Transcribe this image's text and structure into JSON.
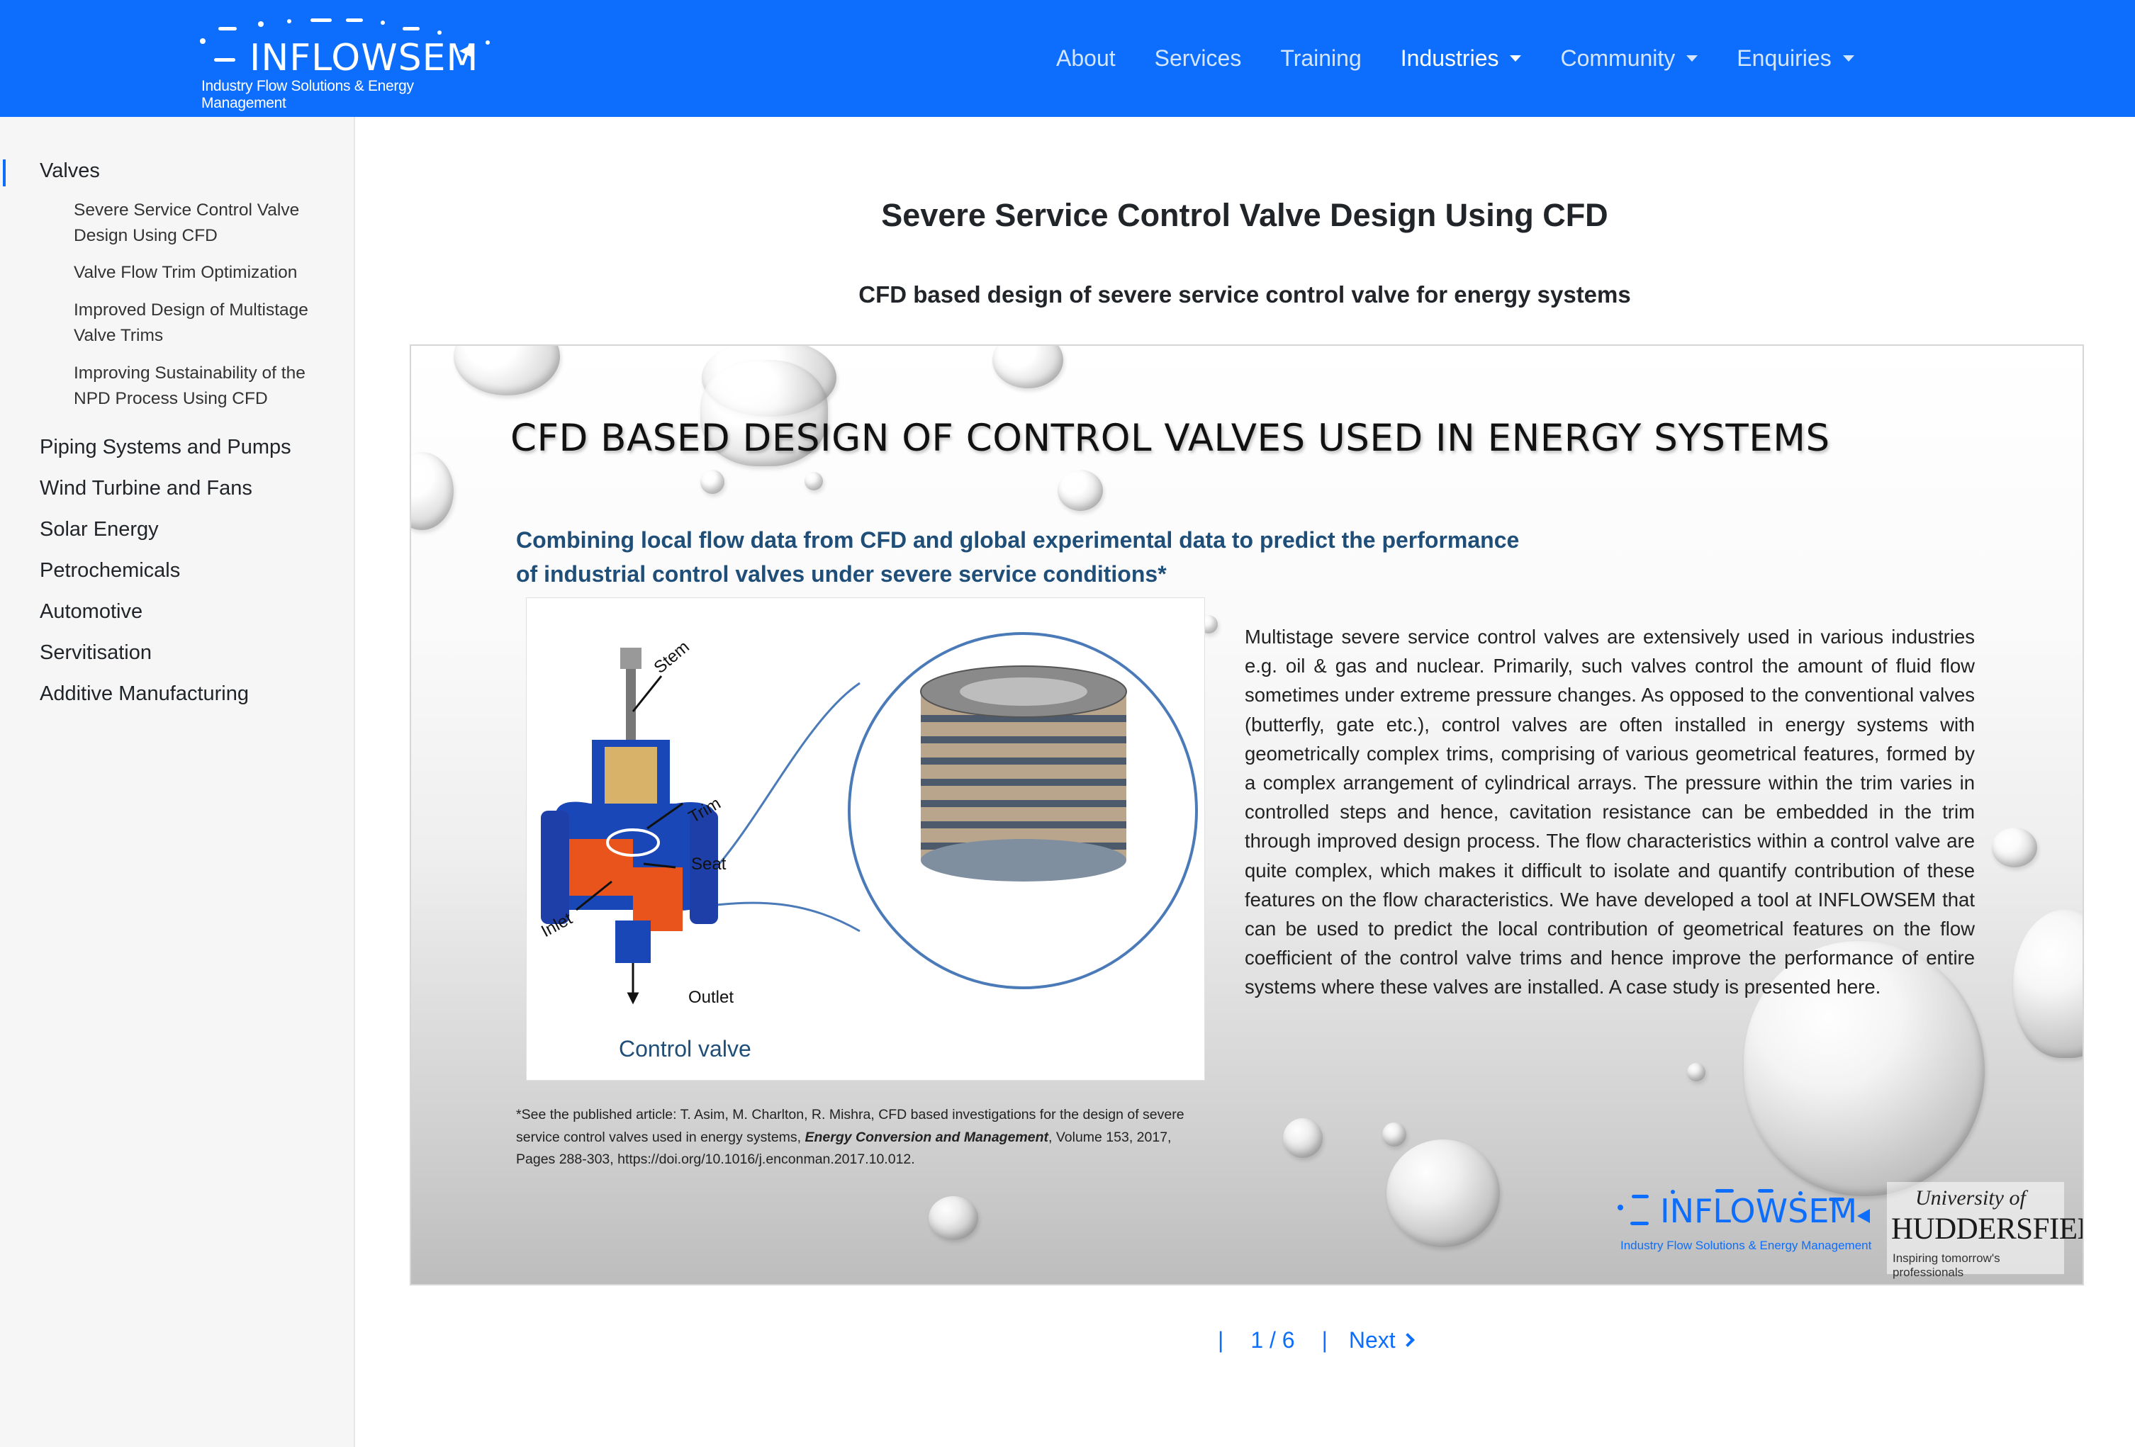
{
  "brand": {
    "name": "INFLOWSEM",
    "tagline": "Industry Flow Solutions & Energy Management"
  },
  "nav": {
    "items": [
      {
        "label": "About",
        "dropdown": false,
        "active": false
      },
      {
        "label": "Services",
        "dropdown": false,
        "active": false
      },
      {
        "label": "Training",
        "dropdown": false,
        "active": false
      },
      {
        "label": "Industries",
        "dropdown": true,
        "active": true
      },
      {
        "label": "Community",
        "dropdown": true,
        "active": false
      },
      {
        "label": "Enquiries",
        "dropdown": true,
        "active": false
      }
    ]
  },
  "sidebar": {
    "categories": [
      {
        "label": "Valves",
        "active": true
      },
      {
        "label": "Piping Systems and Pumps"
      },
      {
        "label": "Wind Turbine and Fans"
      },
      {
        "label": "Solar Energy"
      },
      {
        "label": "Petrochemicals"
      },
      {
        "label": "Automotive"
      },
      {
        "label": "Servitisation"
      },
      {
        "label": "Additive Manufacturing"
      }
    ],
    "valves_sub": [
      "Severe Service Control Valve Design Using CFD",
      "Valve Flow Trim Optimization",
      "Improved Design of Multistage Valve Trims",
      "Improving Sustainability of the NPD Process Using CFD"
    ]
  },
  "main": {
    "title": "Severe Service Control Valve Design Using CFD",
    "subtitle": "CFD based design of severe service control valve for energy systems"
  },
  "slide": {
    "heading": "CFD BASED DESIGN OF CONTROL VALVES USED IN ENERGY SYSTEMS",
    "lead": "Combining local flow data from CFD and global experimental data to predict the performance of industrial control valves under severe service conditions*",
    "figure": {
      "caption": "Control valve",
      "labels": {
        "stem": "Stem",
        "trim": "Trim",
        "seat": "Seat",
        "inlet": "Inlet",
        "outlet": "Outlet"
      }
    },
    "body": "Multistage severe service control valves are extensively used in various industries e.g. oil & gas and nuclear. Primarily, such valves control the amount of fluid flow sometimes under extreme pressure changes. As opposed to the conventional valves (butterfly, gate etc.), control valves are often installed in energy systems with geometrically complex trims, comprising of various geometrical features, formed by a complex arrangement of cylindrical arrays. The pressure within the trim varies in controlled steps and hence, cavitation resistance can be embedded in the trim through improved design process. The flow characteristics within a control valve are quite complex, which makes it difficult to isolate and quantify contribution of these features on the flow characteristics. We have developed a tool at INFLOWSEM that can be used to predict the local contribution of geometrical features on the flow coefficient of the control valve trims and hence improve the performance of entire systems where these valves are installed. A case study is presented here.",
    "reference": {
      "prefix": "*See the published article: T. Asim, M. Charlton, R. Mishra, CFD based investigations for the design of severe service control valves used in energy systems, ",
      "journal": "Energy Conversion and Management",
      "suffix": ", Volume 153, 2017, Pages 288-303, https://doi.org/10.1016/j.enconman.2017.10.012."
    },
    "logos": {
      "inflowsem": "INFLOWSEM",
      "inflowsem_tagline": "Industry Flow Solutions & Energy Management",
      "university_line1": "University of",
      "university_line2": "HUDDERSFIELD",
      "university_tagline": "Inspiring tomorrow's professionals"
    }
  },
  "pager": {
    "separator": "|",
    "current": "1 / 6",
    "next_label": "Next"
  },
  "colors": {
    "brand_blue": "#0d6efd",
    "slide_text_blue": "#1f4e79",
    "valve_blue": "#1a47b8",
    "valve_orange": "#e8541c"
  }
}
